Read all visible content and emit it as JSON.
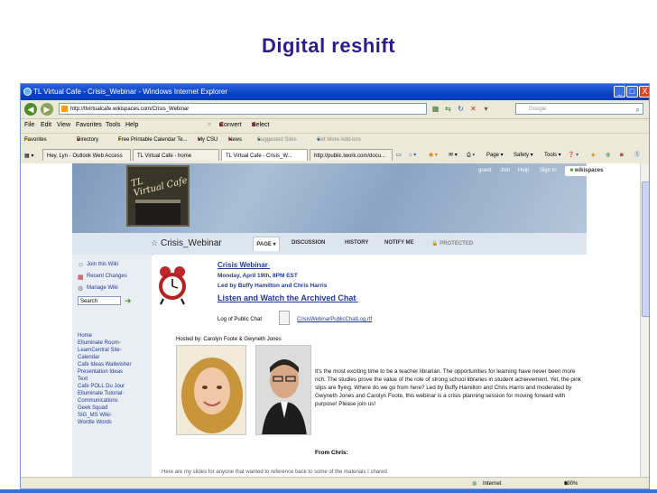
{
  "slide": {
    "title": "Digital  reshift"
  },
  "window": {
    "title": "TL Virtual Cafe - Crisis_Webinar - Windows Internet Explorer",
    "address": "http://tlvirtualcafe.wikispaces.com/Crisis_Webinar",
    "search_placeholder": "Google",
    "min_label": "_",
    "max_label": "□",
    "close_label": "X"
  },
  "menu": {
    "file": "File",
    "edit": "Edit",
    "view": "View",
    "favorites": "Favorites",
    "tools": "Tools",
    "help": "Help",
    "convert": "Convert",
    "select": "Select"
  },
  "favorites_bar": {
    "favorites": "Favorites",
    "items": [
      "Directory",
      "Free Printable Calendar Te...",
      "My CSU",
      "News",
      "Suggested Sites",
      "Get More Add-ons"
    ]
  },
  "tabs": [
    "Hey, Lyn - Outlook Web Access",
    "TL Virtual Cafe - home",
    "TL Virtual Cafe - Crisis_W...",
    "http://public.iwork.com/docu..."
  ],
  "toolbar_right": {
    "page": "Page",
    "safety": "Safety",
    "tools": "Tools"
  },
  "wiki": {
    "logo_text": "TL\nVirtual\nCafe",
    "header_links": {
      "guest": "guest",
      "join": "Join",
      "help": "Help",
      "signin": "Sign In"
    },
    "wikispaces_badge": "wikispaces",
    "page_title": "Crisis_Webinar",
    "page_tabs": {
      "page": "PAGE",
      "discussion": "DISCUSSION",
      "history": "HISTORY",
      "notify": "NOTIFY ME",
      "protected": "PROTECTED"
    },
    "side_actions": {
      "join": "Join this Wiki",
      "recent": "Recent Changes",
      "manage": "Manage Wiki"
    },
    "search_value": "Search",
    "nav": [
      "Home",
      "Elluminate Room",
      "LearnCentral Site",
      "Calendar",
      "Cafe Ideas Wallwisher",
      "Presentation Ideas",
      "Text",
      "Cafe POLL Du Jour",
      "Elluminate Tutorial",
      "Communications",
      "Geek Squad",
      "SIG_MS Wiki",
      "Wordle Words"
    ]
  },
  "main": {
    "heading": "Crisis Webinar",
    "date": "Monday, April 19th, 8PM EST",
    "led_by": "Led by Buffy Hamilton and Chris Harris",
    "listen_link": "Listen and Watch the Archived Chat",
    "log_label": "Log of Public Chat",
    "log_file": "CrisisWebinarPublicChatLog.rtf",
    "hosted_by": "Hosted by: Carolyn Foote & Gwyneth Jones",
    "description": "It's the most exciting time to be a teacher librarian. The opportunities for learning have never been more rich. The studies prove the value of the role of strong school libraries in student achievement. Yet, the pink slips are flying. Where do we go from here? Led by Buffy Hamilton and Chris Harris and moderated by Gwyneth Jones and Carolyn Foote, this webinar is a crisis planning session for moving forward with purpose! Please join us!",
    "from_chris": "From Chris:",
    "cut_line": "Here are my slides for anyone that wanted to reference back to some of the materials I shared"
  },
  "status": {
    "zone": "Internet",
    "zoom": "100%"
  },
  "colors": {
    "title": "#2e1a8c",
    "titlebar": "#0b43c4",
    "link": "#1f3a93"
  }
}
